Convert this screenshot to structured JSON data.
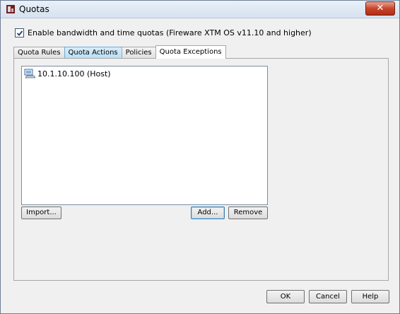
{
  "window": {
    "title": "Quotas",
    "close_glyph": "✕"
  },
  "enable_quotas": {
    "checked": true,
    "label": "Enable bandwidth and time quotas (Fireware XTM OS v11.10 and higher)"
  },
  "tabs": [
    {
      "label": "Quota Rules",
      "active": false
    },
    {
      "label": "Quota Actions",
      "active": false
    },
    {
      "label": "Policies",
      "active": false
    },
    {
      "label": "Quota Exceptions",
      "active": true
    }
  ],
  "exceptions": {
    "items": [
      {
        "label": "10.1.10.100 (Host)",
        "icon": "host-icon"
      }
    ],
    "import_label": "Import...",
    "add_label": "Add...",
    "remove_label": "Remove"
  },
  "footer": {
    "ok_label": "OK",
    "cancel_label": "Cancel",
    "help_label": "Help"
  },
  "colors": {
    "titlebar": "#d6e2ef",
    "close_button": "#c8452b",
    "tab_highlight": "#b9dff7"
  }
}
